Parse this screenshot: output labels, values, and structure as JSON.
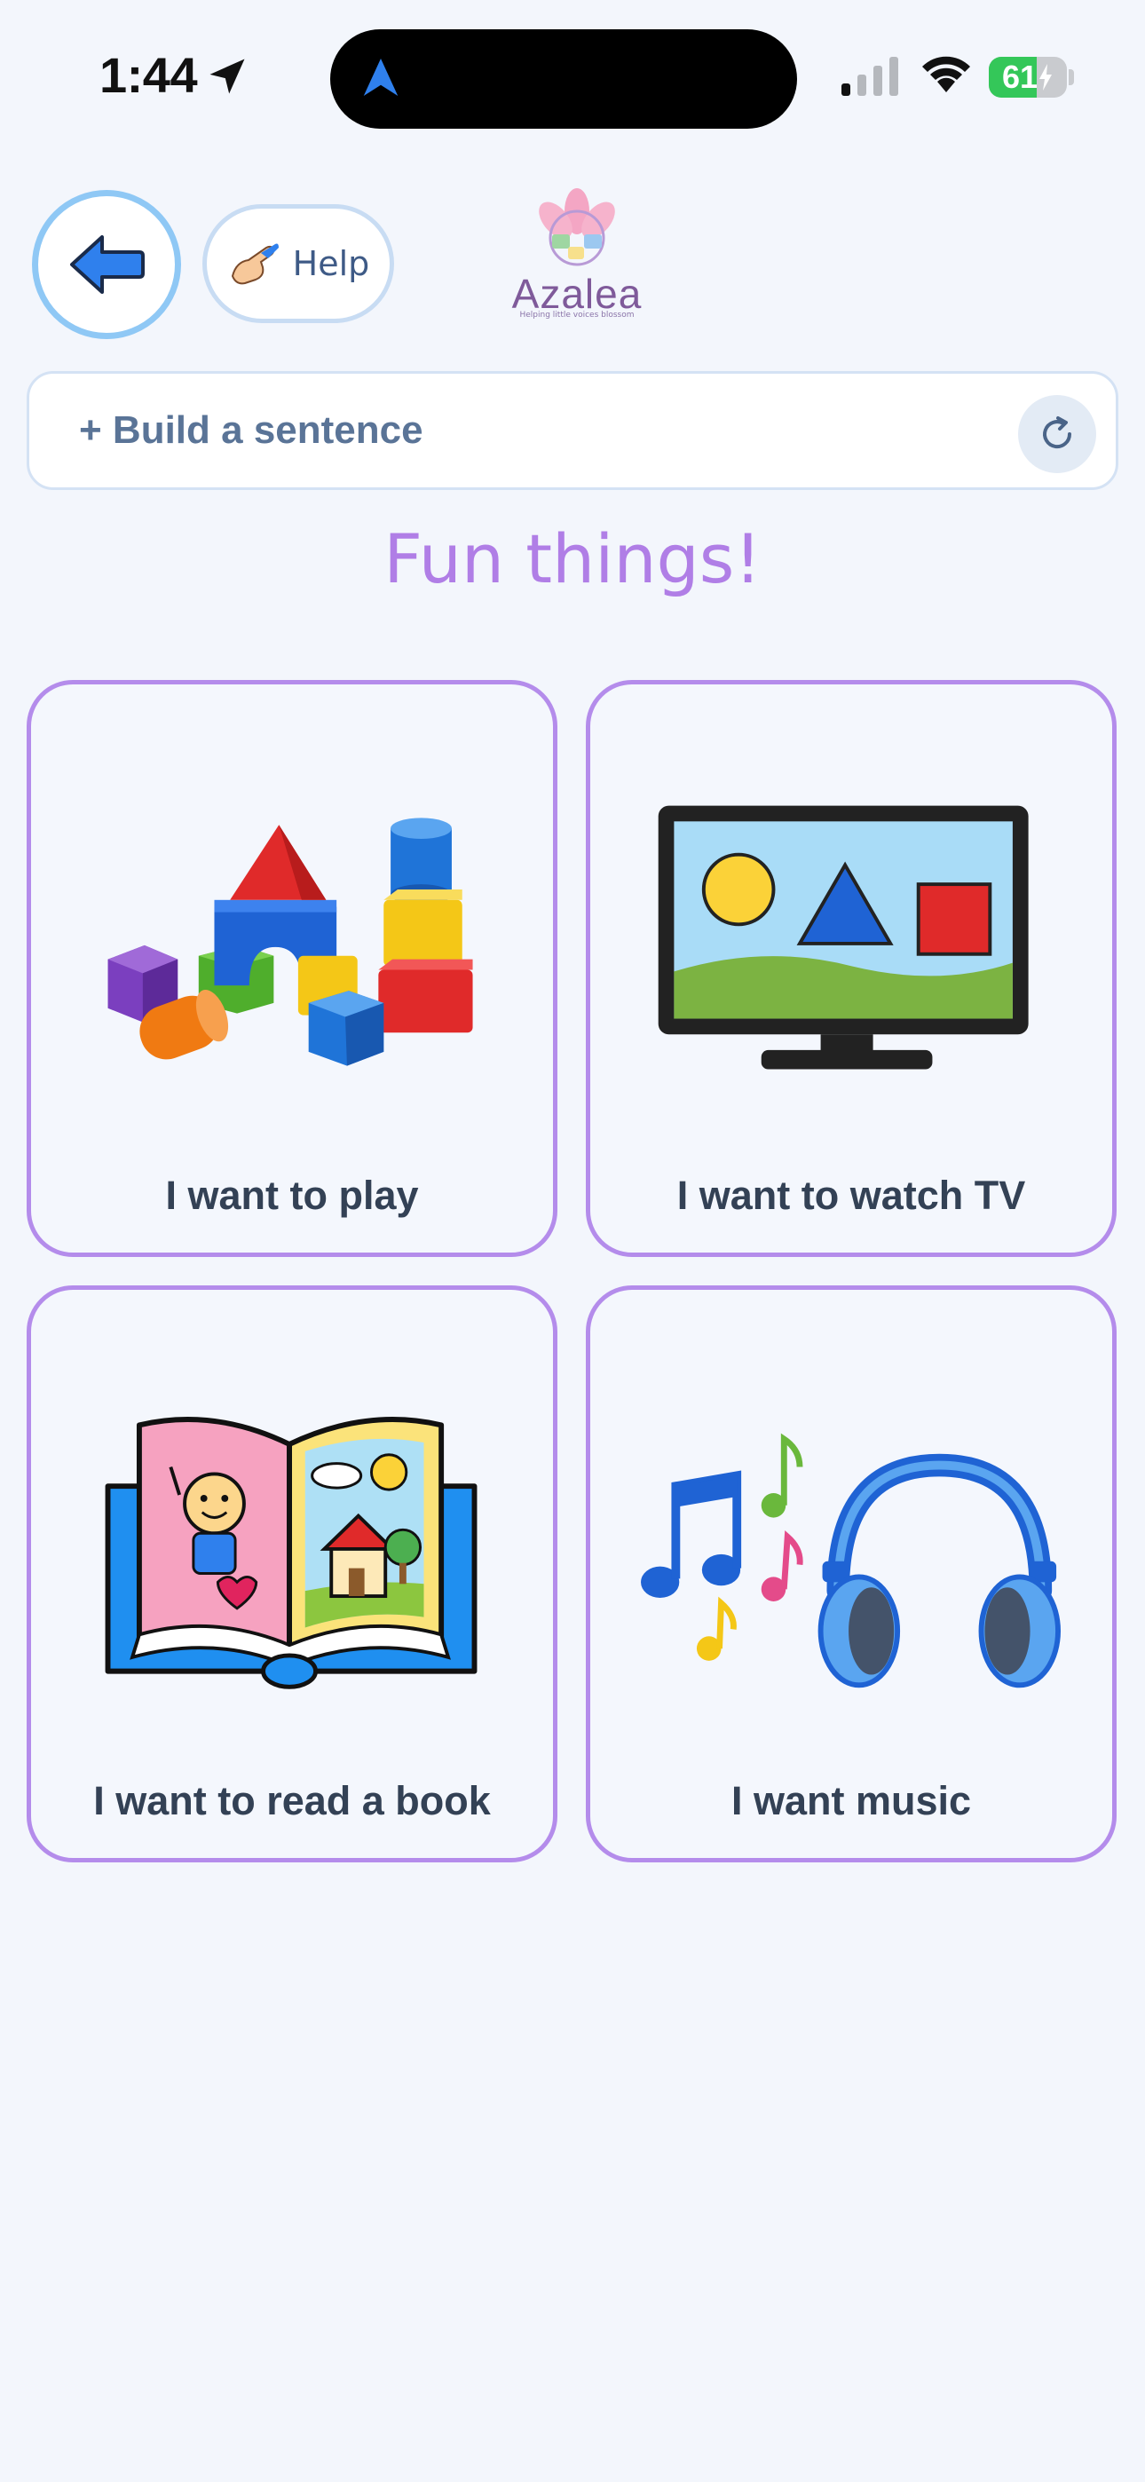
{
  "status_bar": {
    "time": "1:44",
    "battery_level": 61,
    "battery_label": "61",
    "colors": {
      "battery": "#34c759"
    },
    "icons": [
      "location-arrow-icon",
      "navigation-icon",
      "signal-icon",
      "wifi-icon",
      "battery-charging-icon"
    ]
  },
  "header": {
    "back_icon": "arrow-left-icon",
    "help_label": "Help",
    "help_icon": "pointing-hand-icon",
    "logo": {
      "name": "Azalea",
      "tagline": "Helping little voices blossom"
    }
  },
  "sentence_bar": {
    "placeholder": "+ Build a sentence",
    "refresh_icon": "refresh-icon"
  },
  "title": "Fun things!",
  "cards": [
    {
      "label": "I want to play",
      "icon": "toy-blocks-icon"
    },
    {
      "label": "I want to watch TV",
      "icon": "television-icon"
    },
    {
      "label": "I want to read a book",
      "icon": "open-book-icon"
    },
    {
      "label": "I want music",
      "icon": "music-headphones-icon"
    }
  ],
  "colors": {
    "background": "#f3f6fc",
    "card_border": "#b48ceb",
    "title": "#b07ee6",
    "back_ring": "#8fc8f5",
    "accent_blue": "#2f80ed"
  }
}
